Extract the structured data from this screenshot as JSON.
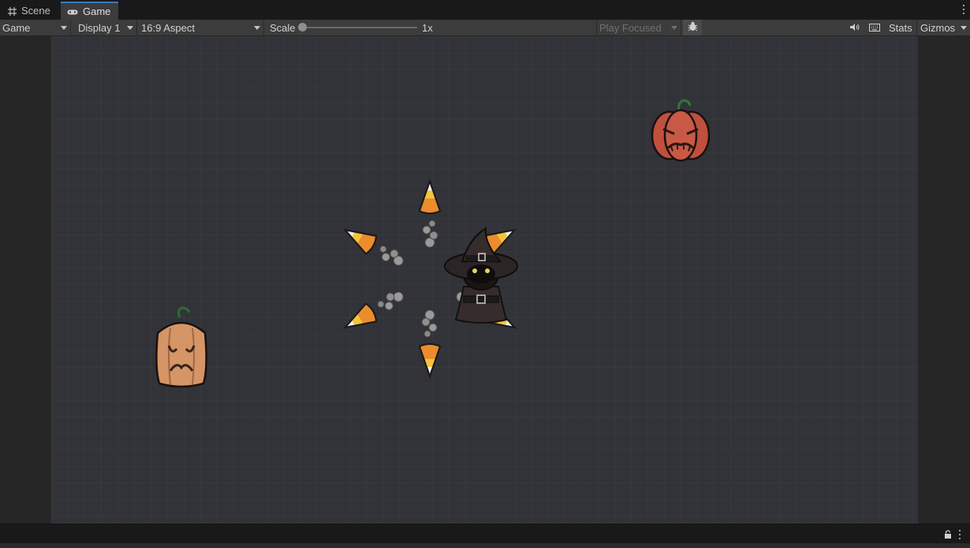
{
  "tabs": [
    {
      "label": "Scene",
      "icon": "grid-icon",
      "active": false
    },
    {
      "label": "Game",
      "icon": "gamepad-icon",
      "active": true
    }
  ],
  "toolbar": {
    "mode_label": "Game",
    "display_label": "Display 1",
    "aspect_label": "16:9 Aspect",
    "scale_label": "Scale",
    "scale_value": "1x",
    "scale_fraction": 0.0,
    "play_focused_label": "Play Focused",
    "stats_label": "Stats",
    "gizmos_label": "Gizmos"
  },
  "icons": {
    "bug": "bug-icon",
    "audio": "speaker-icon",
    "keyboard": "keyboard-icon",
    "more": "kebab-menu-icon",
    "lock": "lock-icon"
  },
  "colors": {
    "accent": "#3a79bb",
    "panel": "#3c3c3c",
    "game_bg": "#323338",
    "pumpkin_orange": "#c8553f",
    "pumpkin_pale": "#d9976b",
    "candy_yellow": "#f3c43a",
    "candy_orange": "#ec8c2c",
    "witch_dark": "#2a2424"
  }
}
